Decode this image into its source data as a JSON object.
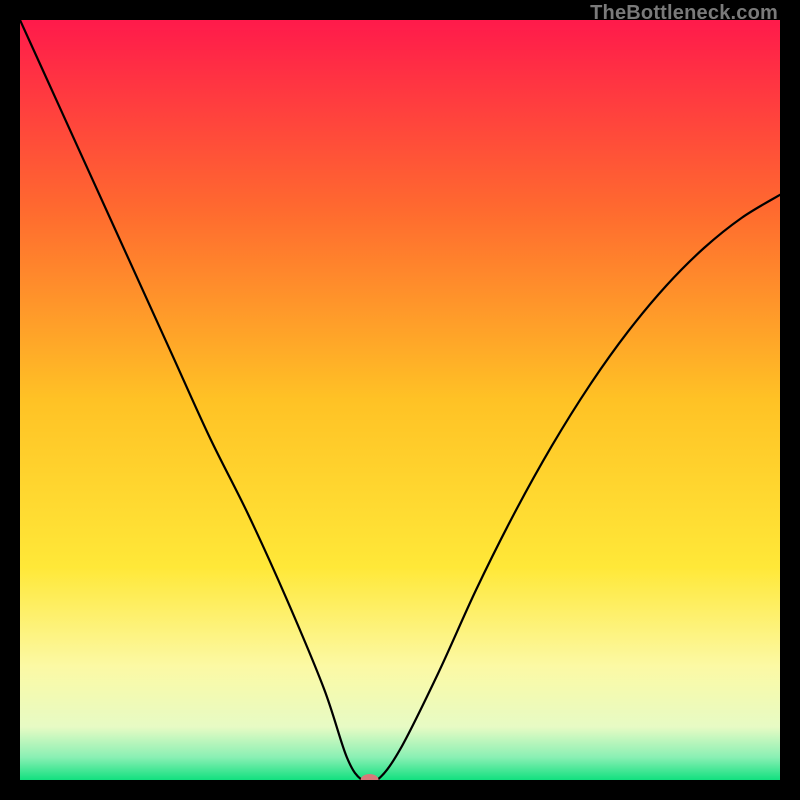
{
  "watermark": "TheBottleneck.com",
  "chart_data": {
    "type": "line",
    "title": "",
    "xlabel": "",
    "ylabel": "",
    "xlim": [
      0,
      100
    ],
    "ylim": [
      0,
      100
    ],
    "grid": false,
    "legend": false,
    "series": [
      {
        "name": "bottleneck-curve",
        "x": [
          0,
          5,
          10,
          15,
          20,
          25,
          30,
          35,
          40,
          43,
          45,
          47,
          50,
          55,
          60,
          65,
          70,
          75,
          80,
          85,
          90,
          95,
          100
        ],
        "values": [
          100,
          89,
          78,
          67,
          56,
          45,
          35,
          24,
          12,
          3,
          0,
          0,
          4,
          14,
          25,
          35,
          44,
          52,
          59,
          65,
          70,
          74,
          77
        ]
      }
    ],
    "marker": {
      "x": 46,
      "y": 0,
      "color": "#d87a7a"
    },
    "background_gradient": {
      "stops": [
        {
          "offset": 0.0,
          "color": "#ff1a4b"
        },
        {
          "offset": 0.25,
          "color": "#ff6a2f"
        },
        {
          "offset": 0.5,
          "color": "#ffc225"
        },
        {
          "offset": 0.72,
          "color": "#ffe838"
        },
        {
          "offset": 0.85,
          "color": "#fcf9a4"
        },
        {
          "offset": 0.93,
          "color": "#e7fbc4"
        },
        {
          "offset": 0.97,
          "color": "#8af0b4"
        },
        {
          "offset": 1.0,
          "color": "#12e07f"
        }
      ]
    }
  }
}
